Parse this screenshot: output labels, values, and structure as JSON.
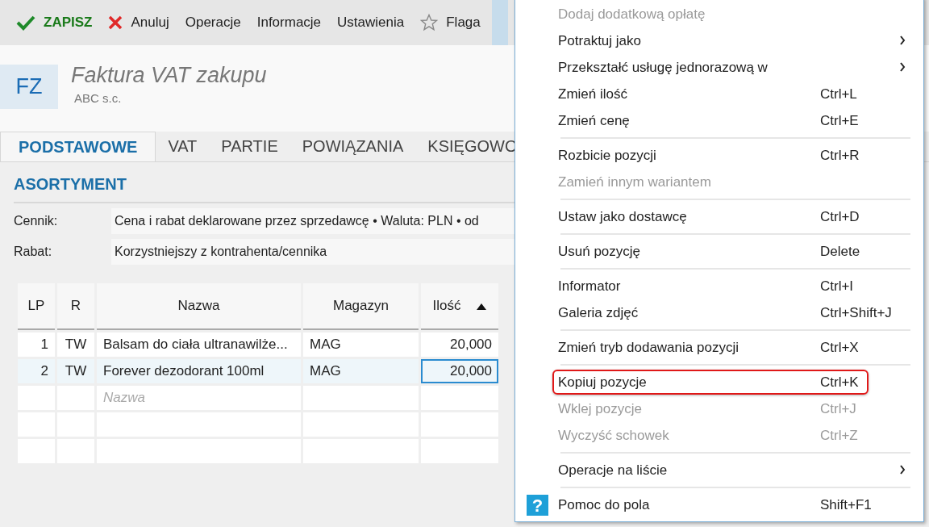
{
  "toolbar": [
    {
      "label": "ZAPISZ",
      "kind": "save"
    },
    {
      "label": "Anuluj",
      "kind": "cancel"
    },
    {
      "label": "Operacje",
      "kind": "plain"
    },
    {
      "label": "Informacje",
      "kind": "plain"
    },
    {
      "label": "Ustawienia",
      "kind": "plain"
    },
    {
      "label": "Flaga",
      "kind": "flag"
    }
  ],
  "document": {
    "badge": "FZ",
    "title": "Faktura VAT zakupu",
    "subtitle": "ABC s.c."
  },
  "tabs": [
    {
      "label": "PODSTAWOWE",
      "selected": true
    },
    {
      "label": "VAT",
      "selected": false
    },
    {
      "label": "PARTIE",
      "selected": false
    },
    {
      "label": "POWIĄZANIA",
      "selected": false
    },
    {
      "label": "KSIĘGOWO",
      "selected": false
    }
  ],
  "section_title": "ASORTYMENT",
  "fields": [
    {
      "label": "Cennik:",
      "value": "Cena i rabat deklarowane przez sprzedawcę • Waluta: PLN • od"
    },
    {
      "label": "Rabat:",
      "value": "Korzystniejszy z kontrahenta/cennika"
    }
  ],
  "table": {
    "columns": [
      {
        "label": "LP",
        "sorted": false
      },
      {
        "label": "R",
        "sorted": false
      },
      {
        "label": "Nazwa",
        "sorted": false
      },
      {
        "label": "Magazyn",
        "sorted": false
      },
      {
        "label": "Ilość",
        "sorted": true
      }
    ],
    "rows": [
      {
        "cells": [
          "1",
          "TW",
          "Balsam do ciała ultranawilże...",
          "MAG",
          "20,000"
        ],
        "selected": false
      },
      {
        "cells": [
          "2",
          "TW",
          "Forever dezodorant 100ml",
          "MAG",
          "20,000"
        ],
        "selected": true
      }
    ],
    "new_row_placeholder": "Nazwa"
  },
  "context_menu": {
    "sections": [
      [
        {
          "label": "Dodaj dodatkową opłatę",
          "disabled": true,
          "submenu": false,
          "highlighted": false,
          "kind": "plain"
        },
        {
          "label": "Potraktuj jako",
          "disabled": false,
          "submenu": true,
          "highlighted": false,
          "kind": "plain"
        },
        {
          "label": "Przekształć usługę jednorazową w",
          "disabled": false,
          "submenu": true,
          "highlighted": false,
          "kind": "plain"
        },
        {
          "label": "Zmień ilość",
          "shortcut": "Ctrl+L",
          "disabled": false,
          "submenu": false,
          "highlighted": false,
          "kind": "plain"
        },
        {
          "label": "Zmień cenę",
          "shortcut": "Ctrl+E",
          "disabled": false,
          "submenu": false,
          "highlighted": false,
          "kind": "plain"
        }
      ],
      [
        {
          "label": "Rozbicie pozycji",
          "shortcut": "Ctrl+R",
          "disabled": false,
          "submenu": false,
          "highlighted": false,
          "kind": "plain"
        },
        {
          "label": "Zamień innym wariantem",
          "disabled": true,
          "submenu": false,
          "highlighted": false,
          "kind": "plain"
        }
      ],
      [
        {
          "label": "Ustaw jako dostawcę",
          "shortcut": "Ctrl+D",
          "disabled": false,
          "submenu": false,
          "highlighted": false,
          "kind": "plain"
        }
      ],
      [
        {
          "label": "Usuń pozycję",
          "shortcut": "Delete",
          "disabled": false,
          "submenu": false,
          "highlighted": false,
          "kind": "plain"
        }
      ],
      [
        {
          "label": "Informator",
          "shortcut": "Ctrl+I",
          "disabled": false,
          "submenu": false,
          "highlighted": false,
          "kind": "plain"
        },
        {
          "label": "Galeria zdjęć",
          "shortcut": "Ctrl+Shift+J",
          "disabled": false,
          "submenu": false,
          "highlighted": false,
          "kind": "plain"
        }
      ],
      [
        {
          "label": "Zmień tryb dodawania pozycji",
          "shortcut": "Ctrl+X",
          "disabled": false,
          "submenu": false,
          "highlighted": false,
          "kind": "plain"
        }
      ],
      [
        {
          "label": "Kopiuj pozycje",
          "shortcut": "Ctrl+K",
          "disabled": false,
          "submenu": false,
          "highlighted": true,
          "kind": "plain"
        },
        {
          "label": "Wklej pozycje",
          "shortcut": "Ctrl+J",
          "disabled": true,
          "submenu": false,
          "highlighted": false,
          "kind": "plain"
        },
        {
          "label": "Wyczyść schowek",
          "shortcut": "Ctrl+Z",
          "disabled": true,
          "submenu": false,
          "highlighted": false,
          "kind": "plain"
        }
      ],
      [
        {
          "label": "Operacje na liście",
          "disabled": false,
          "submenu": true,
          "highlighted": false,
          "kind": "plain"
        }
      ],
      [
        {
          "label": "Pomoc do pola",
          "shortcut": "Shift+F1",
          "disabled": false,
          "submenu": false,
          "highlighted": false,
          "kind": "help",
          "icon": "?"
        }
      ]
    ]
  }
}
